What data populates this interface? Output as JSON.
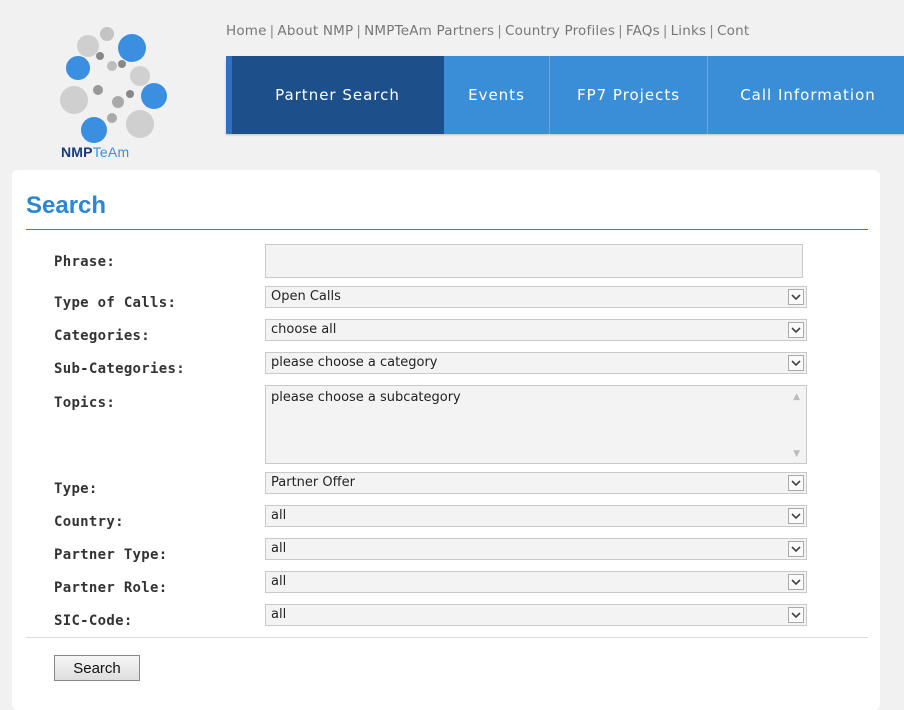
{
  "branding": {
    "logo_main": "NMP",
    "logo_accent": "TeAm"
  },
  "top_links": [
    "Home",
    "About NMP",
    "NMPTeAm Partners",
    "Country Profiles",
    "FAQs",
    "Links",
    "Cont"
  ],
  "nav": {
    "items": [
      "Partner Search",
      "Events",
      "FP7 Projects",
      "Call Information"
    ],
    "active_index": 0
  },
  "search": {
    "title": "Search",
    "labels": {
      "phrase": "Phrase:",
      "type_of_calls": "Type of Calls:",
      "categories": "Categories:",
      "sub_categories": "Sub-Categories:",
      "topics": "Topics:",
      "type": "Type:",
      "country": "Country:",
      "partner_type": "Partner Type:",
      "partner_role": "Partner Role:",
      "sic_code": "SIC-Code:"
    },
    "values": {
      "phrase": "",
      "type_of_calls": "Open Calls",
      "categories": "choose all",
      "sub_categories": "please choose a category",
      "topics": "please choose a subcategory",
      "type": "Partner Offer",
      "country": "all",
      "partner_type": "all",
      "partner_role": "all",
      "sic_code": "all"
    },
    "button": "Search"
  },
  "colors": {
    "accent": "#2b86d3",
    "nav_bg": "#3a8ed8",
    "nav_active": "#1d4f8a",
    "logo_dark": "#1a3a7a"
  }
}
